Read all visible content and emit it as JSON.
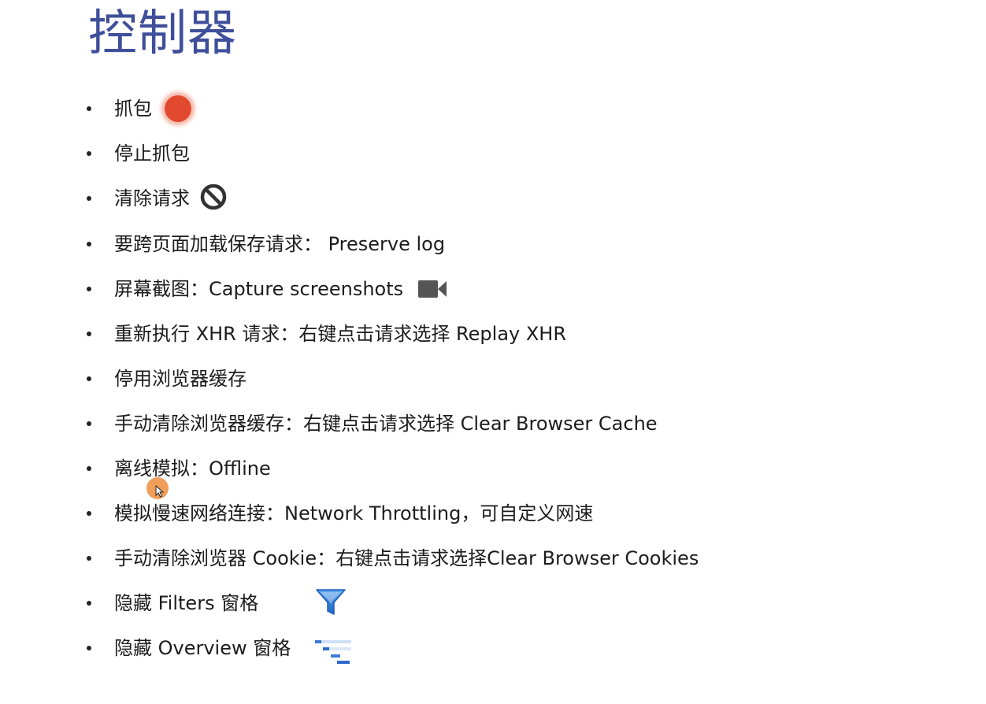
{
  "title": "控制器",
  "items": [
    {
      "text": "抓包",
      "icon": "record-icon"
    },
    {
      "text": "停止抓包"
    },
    {
      "text": "清除请求",
      "icon": "clear-icon"
    },
    {
      "text": "要跨页面加载保存请求：  Preserve log"
    },
    {
      "text": "屏幕截图：Capture screenshots",
      "icon": "camera-icon"
    },
    {
      "text": "重新执行 XHR 请求：右键点击请求选择 Replay XHR"
    },
    {
      "text": "停用浏览器缓存"
    },
    {
      "text": "手动清除浏览器缓存：右键点击请求选择 Clear Browser Cache"
    },
    {
      "text": "离线模拟：Offline"
    },
    {
      "text": "模拟慢速网络连接：Network Throttling，可自定义网速"
    },
    {
      "text": "手动清除浏览器 Cookie：右键点击请求选择Clear Browser Cookies"
    },
    {
      "text": "隐藏 Filters 窗格",
      "icon": "filter-icon"
    },
    {
      "text": "隐藏 Overview 窗格",
      "icon": "overview-icon"
    }
  ],
  "colors": {
    "title": "#3f4f9a",
    "record": "#e24a30",
    "icon_blue": "#2e7bd6",
    "cursor": "#ee9448"
  }
}
